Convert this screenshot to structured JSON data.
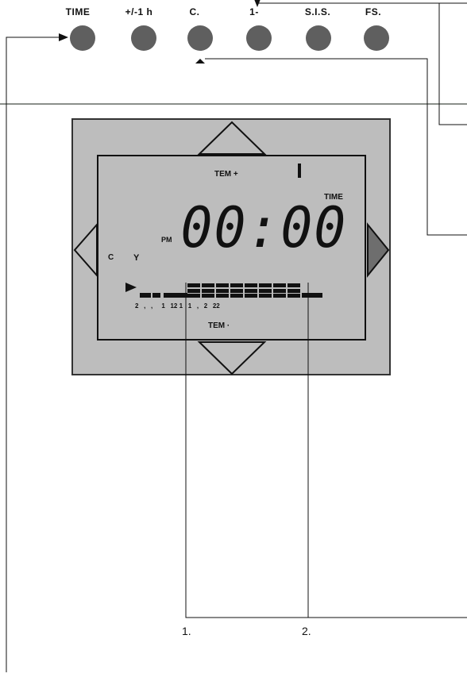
{
  "buttons": [
    {
      "label": "TIME",
      "icon": "circle-button"
    },
    {
      "label": "+/-1 h",
      "icon": "circle-button"
    },
    {
      "label": "C.",
      "icon": "circle-button"
    },
    {
      "label": "1-",
      "icon": "circle-button"
    },
    {
      "label": "S.I.S.",
      "icon": "circle-button"
    },
    {
      "label": "FS.",
      "icon": "circle-button"
    }
  ],
  "display": {
    "top_label": "TEM +",
    "right_label": "TIME",
    "digits": "00:00",
    "am_pm": "PM",
    "left_label_1": "C",
    "left_label_2": "Y",
    "hour_ticks": "2   ,   ,     1   12 1   1   ,   2   22",
    "bottom_label": "TEM ·"
  },
  "callouts": {
    "first": "1.",
    "second": "2."
  },
  "colors": {
    "panel": "#bdbdbd",
    "button": "#5f5f5f",
    "separator": "#8a8f8a"
  }
}
